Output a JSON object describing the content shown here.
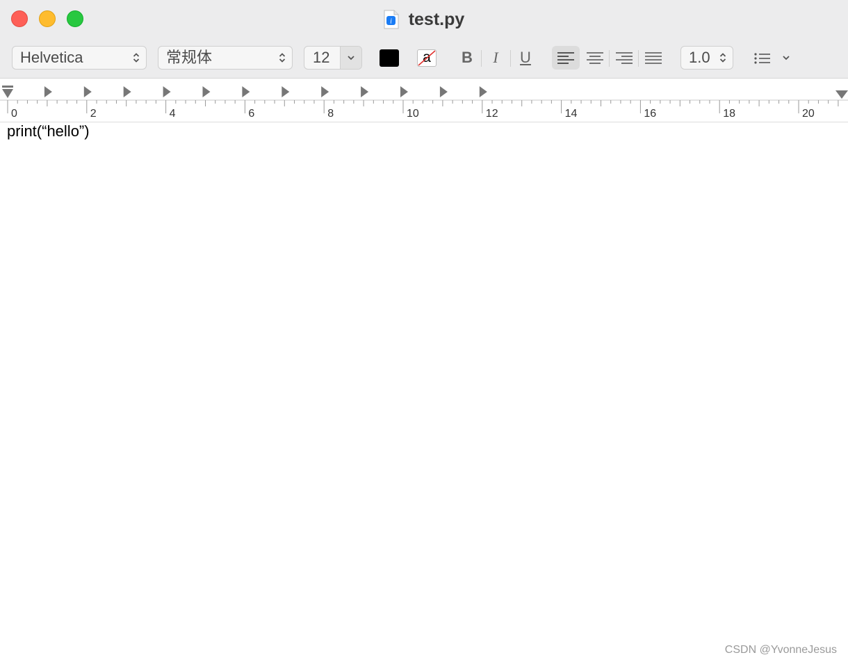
{
  "window": {
    "title": "test.py"
  },
  "toolbar": {
    "font_family": "Helvetica",
    "font_style": "常规体",
    "font_size": "12",
    "text_color": "#000000",
    "highlight_glyph": "a",
    "bold_label": "B",
    "italic_label": "I",
    "underline_label": "U",
    "line_spacing": "1.0"
  },
  "ruler": {
    "labels": [
      "0",
      "2",
      "4",
      "6",
      "8",
      "10",
      "12",
      "14",
      "16",
      "18",
      "20"
    ]
  },
  "document": {
    "content": "print(“hello”)"
  },
  "watermark": "CSDN @YvonneJesus"
}
